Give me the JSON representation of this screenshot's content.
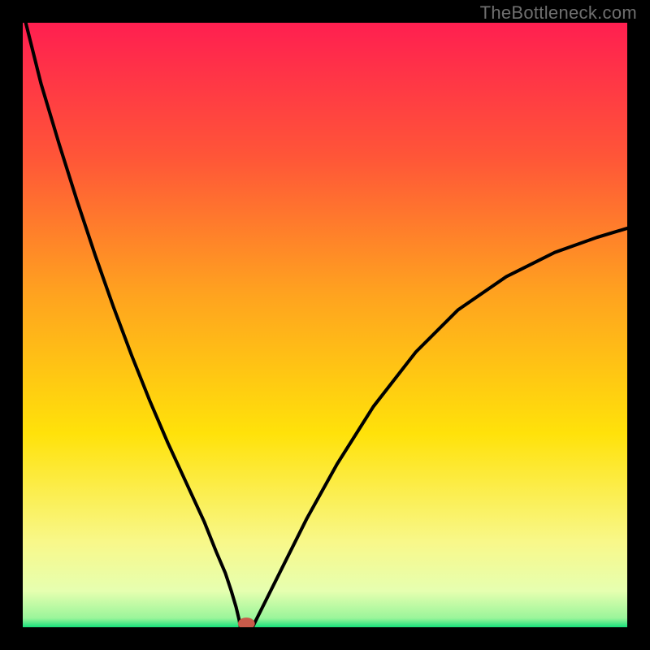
{
  "watermark": "TheBottleneck.com",
  "chart_data": {
    "type": "line",
    "title": "",
    "xlabel": "",
    "ylabel": "",
    "xlim": [
      0,
      100
    ],
    "ylim": [
      0,
      100
    ],
    "annotations": [],
    "background_gradient": [
      {
        "offset": 0.0,
        "color": "#ff1f50"
      },
      {
        "offset": 0.22,
        "color": "#ff5538"
      },
      {
        "offset": 0.45,
        "color": "#ffa31f"
      },
      {
        "offset": 0.68,
        "color": "#ffe20a"
      },
      {
        "offset": 0.86,
        "color": "#f8f88a"
      },
      {
        "offset": 0.94,
        "color": "#e6ffb0"
      },
      {
        "offset": 0.985,
        "color": "#9af59a"
      },
      {
        "offset": 1.0,
        "color": "#17e07b"
      }
    ],
    "floor_y": 0,
    "trough": {
      "x": 36,
      "y": 0
    },
    "marker": {
      "x": 37,
      "y": 0.6,
      "color": "#c95b4a",
      "rx": 1.4,
      "ry": 1.0
    },
    "series": [
      {
        "name": "left-arm",
        "x": [
          0.5,
          3,
          6,
          9,
          12,
          15,
          18,
          21,
          24,
          27,
          30,
          32,
          33.5,
          34.5,
          35.3,
          35.8,
          36
        ],
        "y": [
          100,
          90,
          80,
          70.5,
          61.5,
          53,
          45,
          37.5,
          30.5,
          24,
          17.5,
          12.5,
          9,
          6,
          3.3,
          1.2,
          0
        ]
      },
      {
        "name": "flat",
        "x": [
          36,
          38
        ],
        "y": [
          0,
          0
        ]
      },
      {
        "name": "right-arm",
        "x": [
          38,
          40,
          43,
          47,
          52,
          58,
          65,
          72,
          80,
          88,
          95,
          100
        ],
        "y": [
          0,
          4,
          10,
          18,
          27,
          36.5,
          45.5,
          52.5,
          58,
          62,
          64.5,
          66
        ]
      }
    ]
  }
}
